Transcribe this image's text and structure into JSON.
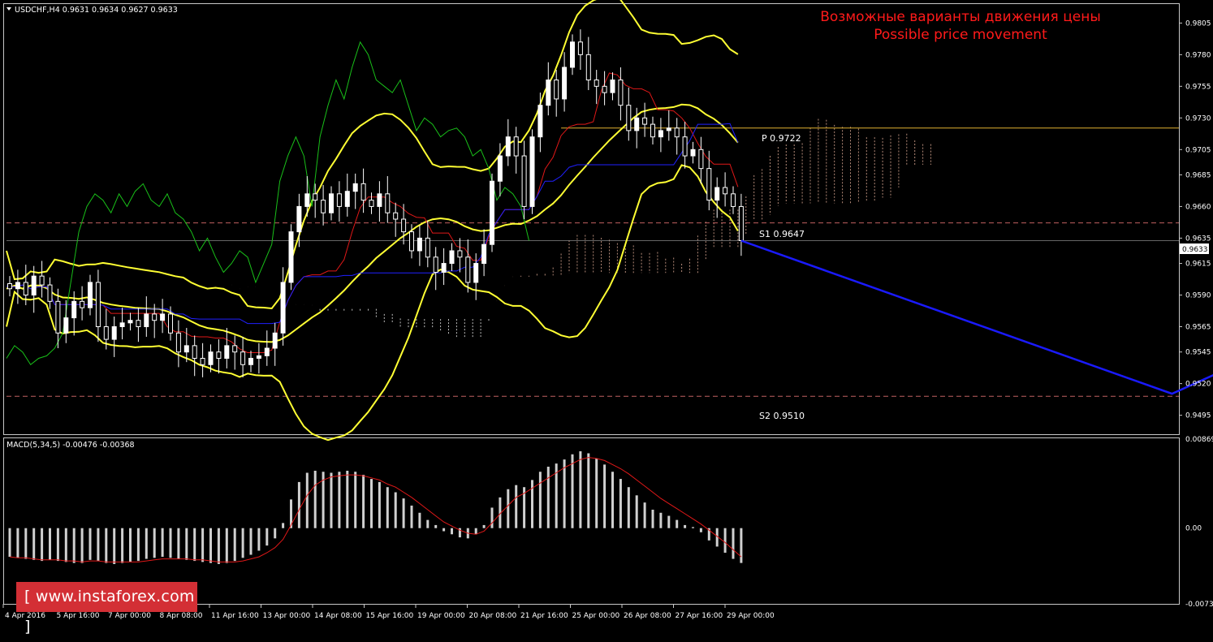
{
  "header": {
    "symbol_line": "USDCHF,H4  0.9631 0.9634 0.9627 0.9633"
  },
  "annotation": {
    "title_ru": "Возможные варианты движения цены",
    "title_en": "Possible price movement",
    "color": "#ff1a1a"
  },
  "macd_header": "MACD(5,34,5) -0.00476 -0.00368",
  "watermark": "[ www.instaforex.com ]",
  "colors": {
    "bull_candle": "#ffffff",
    "bear_candle": "#ffffff",
    "bollinger": "#ffff33",
    "tenkan": "#e01818",
    "kijun": "#2020ff",
    "chikou": "#19c019",
    "cloud_a": "#f0b8a0",
    "cloud_b": "#ffffff",
    "pivot_line": "#e0b030",
    "support_line": "#c06060",
    "projection": "#1a1aff",
    "macd_hist": "#d0d0d0",
    "macd_signal": "#e01818"
  },
  "chart_data": [
    {
      "type": "candlestick",
      "symbol": "USDCHF",
      "timeframe": "H4",
      "ylim": [
        0.948,
        0.982
      ],
      "y_ticks": [
        "0.9805",
        "0.9780",
        "0.9755",
        "0.9730",
        "0.9705",
        "0.9685",
        "0.9660",
        "0.9635",
        "0.9615",
        "0.9590",
        "0.9565",
        "0.9545",
        "0.9520",
        "0.9495"
      ],
      "current_price": "0.9633",
      "current_price_value": 0.9633,
      "x_ticks": [
        "4 Apr 2016",
        "5 Apr 16:00",
        "7 Apr 00:00",
        "8 Apr 08:00",
        "11 Apr 16:00",
        "13 Apr 00:00",
        "14 Apr 08:00",
        "15 Apr 16:00",
        "19 Apr 00:00",
        "20 Apr 08:00",
        "21 Apr 16:00",
        "25 Apr 00:00",
        "26 Apr 08:00",
        "27 Apr 16:00",
        "29 Apr 00:00"
      ],
      "close": [
        0.9595,
        0.96,
        0.959,
        0.9605,
        0.9598,
        0.9585,
        0.956,
        0.9572,
        0.9585,
        0.958,
        0.96,
        0.9565,
        0.9555,
        0.9565,
        0.9568,
        0.957,
        0.9565,
        0.9575,
        0.957,
        0.9575,
        0.956,
        0.9545,
        0.955,
        0.954,
        0.9535,
        0.9545,
        0.954,
        0.955,
        0.9545,
        0.9535,
        0.954,
        0.9542,
        0.9548,
        0.956,
        0.96,
        0.964,
        0.966,
        0.967,
        0.9665,
        0.9655,
        0.967,
        0.966,
        0.9672,
        0.9678,
        0.9665,
        0.966,
        0.967,
        0.9655,
        0.965,
        0.964,
        0.9625,
        0.9635,
        0.962,
        0.9608,
        0.9615,
        0.9625,
        0.962,
        0.96,
        0.9615,
        0.963,
        0.968,
        0.97,
        0.9715,
        0.97,
        0.966,
        0.9715,
        0.974,
        0.976,
        0.9745,
        0.977,
        0.979,
        0.978,
        0.976,
        0.9755,
        0.975,
        0.976,
        0.974,
        0.972,
        0.973,
        0.9725,
        0.9715,
        0.972,
        0.9722,
        0.9715,
        0.97,
        0.9705,
        0.969,
        0.9665,
        0.9675,
        0.967,
        0.966,
        0.9633
      ],
      "bollinger": {
        "period": 20,
        "deviations": 2
      },
      "ichimoku": {
        "tenkan": 9,
        "kijun": 26,
        "senkou": 52
      },
      "levels": [
        {
          "name": "P",
          "label": "P  0.9722",
          "value": 0.9722,
          "style": "solid"
        },
        {
          "name": "S1",
          "label": "S1  0.9647",
          "value": 0.9647,
          "style": "dashed"
        },
        {
          "name": "S2",
          "label": "S2  0.9510",
          "value": 0.951,
          "style": "dashed"
        }
      ],
      "projection": [
        {
          "step": 0,
          "value": 0.9633
        },
        {
          "step": 67,
          "value": 0.9512
        },
        {
          "step": 88,
          "value": 0.956
        }
      ]
    },
    {
      "type": "bar",
      "name": "MACD(5,34,5)",
      "ylim": [
        -0.00739,
        0.00869
      ],
      "y_ticks": [
        "0.00869",
        "0.00",
        "-0.00739"
      ],
      "histogram": [
        -0.0028,
        -0.0029,
        -0.003,
        -0.0031,
        -0.0032,
        -0.0031,
        -0.0032,
        -0.0033,
        -0.0034,
        -0.0034,
        -0.0031,
        -0.0032,
        -0.0034,
        -0.0035,
        -0.0034,
        -0.0033,
        -0.0032,
        -0.003,
        -0.0029,
        -0.0028,
        -0.0029,
        -0.003,
        -0.0031,
        -0.0032,
        -0.0033,
        -0.0034,
        -0.0035,
        -0.0034,
        -0.0032,
        -0.0029,
        -0.0026,
        -0.0022,
        -0.0017,
        -0.001,
        0.0005,
        0.0028,
        0.0045,
        0.0054,
        0.0056,
        0.0055,
        0.0054,
        0.0055,
        0.0056,
        0.0055,
        0.0052,
        0.0048,
        0.0045,
        0.004,
        0.0035,
        0.0029,
        0.0022,
        0.0015,
        0.0008,
        0.0003,
        -0.0003,
        -0.0006,
        -0.0009,
        -0.001,
        -0.0006,
        0.0003,
        0.002,
        0.003,
        0.0038,
        0.0042,
        0.004,
        0.0047,
        0.0055,
        0.006,
        0.0063,
        0.0067,
        0.0072,
        0.0075,
        0.0073,
        0.0068,
        0.0062,
        0.0055,
        0.0048,
        0.004,
        0.0032,
        0.0025,
        0.0018,
        0.0015,
        0.0012,
        0.0008,
        0.0003,
        0.0001,
        -0.0004,
        -0.0012,
        -0.0018,
        -0.0024,
        -0.003,
        -0.0034
      ],
      "signal": [
        -0.0028,
        -0.0029,
        -0.0029,
        -0.003,
        -0.0031,
        -0.0031,
        -0.0031,
        -0.0032,
        -0.0032,
        -0.0033,
        -0.0032,
        -0.0032,
        -0.0033,
        -0.0033,
        -0.0033,
        -0.0033,
        -0.0033,
        -0.0032,
        -0.0031,
        -0.003,
        -0.003,
        -0.003,
        -0.003,
        -0.0031,
        -0.0031,
        -0.0032,
        -0.0033,
        -0.0033,
        -0.0033,
        -0.0032,
        -0.003,
        -0.0028,
        -0.0024,
        -0.0019,
        -0.0011,
        0.0003,
        0.0018,
        0.0032,
        0.0042,
        0.0047,
        0.005,
        0.0051,
        0.0052,
        0.0052,
        0.0051,
        0.0049,
        0.0047,
        0.0043,
        0.004,
        0.0035,
        0.003,
        0.0024,
        0.0018,
        0.0012,
        0.0006,
        0.0002,
        -0.0002,
        -0.0005,
        -0.0006,
        -0.0003,
        0.0005,
        0.0014,
        0.0022,
        0.003,
        0.0034,
        0.0039,
        0.0044,
        0.0049,
        0.0054,
        0.0059,
        0.0063,
        0.0067,
        0.0069,
        0.0068,
        0.0066,
        0.0062,
        0.0058,
        0.0053,
        0.0047,
        0.0041,
        0.0035,
        0.0029,
        0.0024,
        0.0019,
        0.0014,
        0.0009,
        0.0004,
        -0.0002,
        -0.0008,
        -0.0014,
        -0.0021,
        -0.0028
      ]
    }
  ]
}
